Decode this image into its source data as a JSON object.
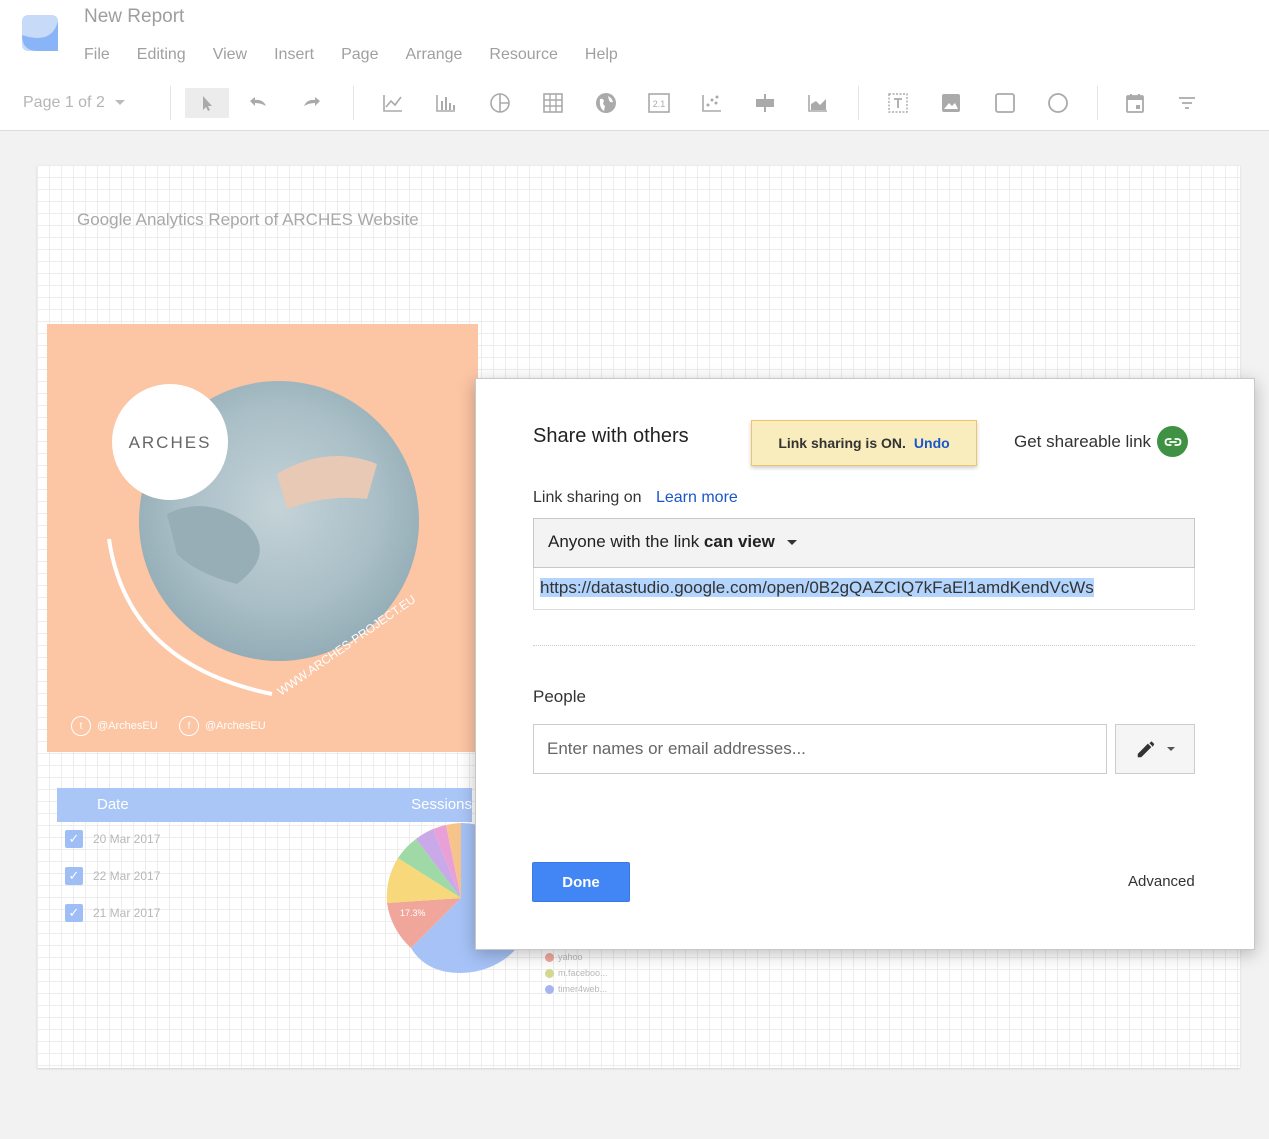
{
  "app": {
    "doc_title": "New Report",
    "menu": [
      "File",
      "Editing",
      "View",
      "Insert",
      "Page",
      "Arrange",
      "Resource",
      "Help"
    ],
    "page_indicator": "Page 1 of 2",
    "toolbar_icons": [
      "select-icon",
      "undo-icon",
      "redo-icon",
      "time-series-icon",
      "bar-chart-icon",
      "pie-chart-icon",
      "table-icon",
      "geo-map-icon",
      "scorecard-icon",
      "scatter-chart-icon",
      "bullet-chart-icon",
      "area-chart-icon",
      "text-icon",
      "image-icon",
      "rectangle-icon",
      "circle-icon",
      "date-range-icon",
      "filter-icon"
    ]
  },
  "report": {
    "title": "Google Analytics Report of ARCHES Website",
    "hero": {
      "logo_text": "ARCHES",
      "url_text": "WWW.ARCHES-PROJECT.EU",
      "twitter": "@ArchesEU",
      "facebook": "@ArchesEU",
      "bg_color": "#fcc5a4"
    },
    "table": {
      "headers": [
        "Date",
        "Sessions"
      ],
      "rows": [
        "20 Mar 2017",
        "22 Mar 2017",
        "21 Mar 2017"
      ]
    },
    "pie_label": "17.3%",
    "legend": [
      "yahoo",
      "m.faceboo...",
      "timer4web..."
    ]
  },
  "share_dialog": {
    "title": "Share with others",
    "notice_text": "Link sharing is ON.",
    "notice_undo": "Undo",
    "get_link": "Get shareable link",
    "link_sharing_label": "Link sharing on",
    "learn_more": "Learn more",
    "access_prefix": "Anyone with the link ",
    "access_level": "can view",
    "url": "https://datastudio.google.com/open/0B2gQAZCIQ7kFaEl1amdKendVcWs",
    "people_label": "People",
    "people_placeholder": "Enter names or email addresses...",
    "done": "Done",
    "advanced": "Advanced",
    "colors": {
      "primary": "#4285f4",
      "link": "#1a56c9",
      "link_icon_bg": "#3f9143",
      "notice_bg": "#f9edbe"
    }
  }
}
